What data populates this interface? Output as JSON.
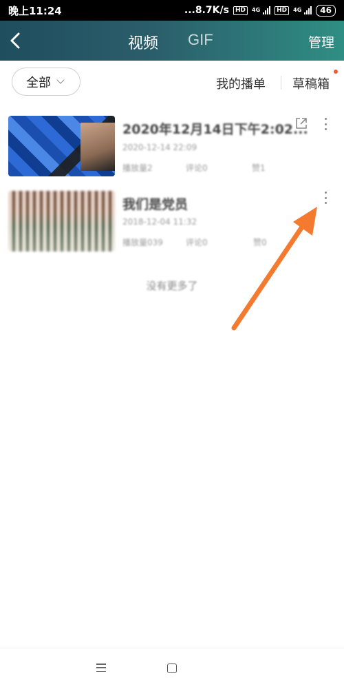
{
  "status_bar": {
    "time": "晚上11:24",
    "speed": "...8.7K/s",
    "hd_badge_1": "HD",
    "net_1": "4G",
    "hd_badge_2": "HD",
    "net_2": "4G",
    "battery": "46"
  },
  "header": {
    "back_icon": "chevron-left-icon",
    "tabs": [
      {
        "label": "视频",
        "active": true
      },
      {
        "label": "GIF",
        "active": false
      }
    ],
    "manage_label": "管理",
    "gradient_colors": [
      "#1f4e5f",
      "#2b5e6b",
      "#2f8e84"
    ]
  },
  "filter": {
    "dropdown_label": "全部",
    "dropdown_icon": "chevron-down-icon",
    "playlist_label": "我的播单",
    "drafts_label": "草稿箱",
    "drafts_badge_color": "#f05a3a"
  },
  "videos": [
    {
      "title": "2020年12月14日下午2:02...",
      "date": "2020-12-14 22:09",
      "meta": [
        "播放量2",
        "评论0",
        "赞1"
      ],
      "has_share": true,
      "share_icon": "external-share-icon",
      "more_icon": "more-vertical-icon"
    },
    {
      "title": "我们是党员",
      "date": "2018-12-04 11:32",
      "meta": [
        "播放量039",
        "评论0",
        "赞0"
      ],
      "has_share": false,
      "more_icon": "more-vertical-icon"
    }
  ],
  "list_footer": "没有更多了",
  "annotation": {
    "arrow_color": "#f47a2f"
  },
  "nav_bar": {
    "menu_icon": "menu-icon",
    "home_icon": "home-square-icon"
  }
}
